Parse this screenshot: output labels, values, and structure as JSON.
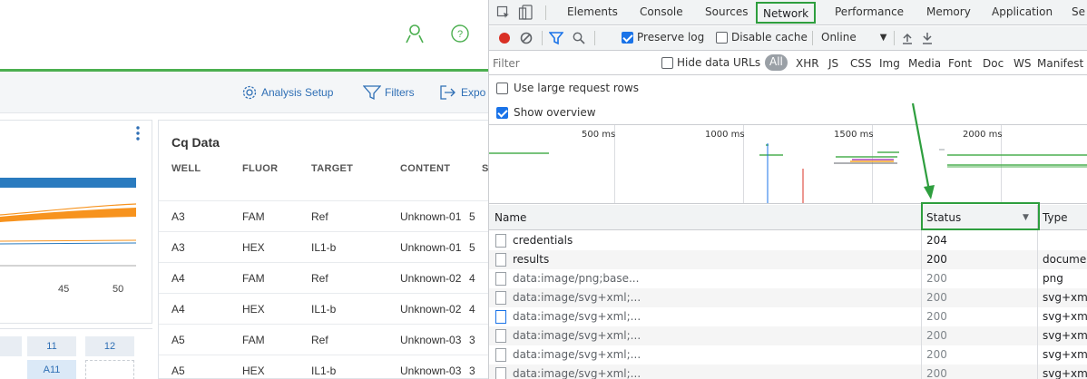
{
  "app": {
    "toolbar": {
      "analysis_setup": "Analysis Setup",
      "filters": "Filters",
      "export": "Expo"
    },
    "chart": {
      "x_ticks": [
        "45",
        "50"
      ]
    },
    "plate": {
      "headers": [
        "11",
        "12"
      ],
      "cells": [
        "A11",
        ""
      ]
    },
    "cq": {
      "title": "Cq Data",
      "headers": [
        "WELL",
        "FLUOR",
        "TARGET",
        "CONTENT",
        "S"
      ],
      "rows": [
        {
          "well": "A3",
          "fluor": "FAM",
          "target": "Ref",
          "content": "Unknown-01",
          "s": "5"
        },
        {
          "well": "A3",
          "fluor": "HEX",
          "target": "IL1-b",
          "content": "Unknown-01",
          "s": "5"
        },
        {
          "well": "A4",
          "fluor": "FAM",
          "target": "Ref",
          "content": "Unknown-02",
          "s": "4"
        },
        {
          "well": "A4",
          "fluor": "HEX",
          "target": "IL1-b",
          "content": "Unknown-02",
          "s": "4"
        },
        {
          "well": "A5",
          "fluor": "FAM",
          "target": "Ref",
          "content": "Unknown-03",
          "s": "3"
        },
        {
          "well": "A5",
          "fluor": "HEX",
          "target": "IL1-b",
          "content": "Unknown-03",
          "s": "3"
        }
      ]
    }
  },
  "devtools": {
    "tabs": [
      "Elements",
      "Console",
      "Sources",
      "Network",
      "Performance",
      "Memory",
      "Application",
      "Se"
    ],
    "active_tab": "Network",
    "toolbar": {
      "preserve_log": "Preserve log",
      "disable_cache": "Disable cache",
      "throttle": "Online"
    },
    "filter": {
      "placeholder": "Filter",
      "hide_data_urls": "Hide data URLs",
      "types": [
        "All",
        "XHR",
        "JS",
        "CSS",
        "Img",
        "Media",
        "Font",
        "Doc",
        "WS",
        "Manifest"
      ]
    },
    "options": {
      "large_rows": "Use large request rows",
      "show_overview": "Show overview"
    },
    "overview_ticks": [
      "500 ms",
      "1000 ms",
      "1500 ms",
      "2000 ms"
    ],
    "table": {
      "headers": {
        "name": "Name",
        "status": "Status",
        "type": "Type"
      },
      "rows": [
        {
          "name": "credentials",
          "status": "204",
          "type": ""
        },
        {
          "name": "results",
          "status": "200",
          "type": "documer"
        },
        {
          "name": "data:image/png;base...",
          "status": "200",
          "type": "png"
        },
        {
          "name": "data:image/svg+xml;...",
          "status": "200",
          "type": "svg+xml"
        },
        {
          "name": "data:image/svg+xml;...",
          "status": "200",
          "type": "svg+xml"
        },
        {
          "name": "data:image/svg+xml;...",
          "status": "200",
          "type": "svg+xml"
        },
        {
          "name": "data:image/svg+xml;...",
          "status": "200",
          "type": "svg+xml"
        },
        {
          "name": "data:image/svg+xml;...",
          "status": "200",
          "type": "svg+xml"
        }
      ]
    }
  },
  "colors": {
    "accent_green": "#2e9e3e",
    "link_blue": "#2f6fb5",
    "record_red": "#d93025",
    "checkbox_blue": "#1a73e8",
    "series_blue": "#2a7bbf",
    "series_orange": "#f7931e"
  }
}
